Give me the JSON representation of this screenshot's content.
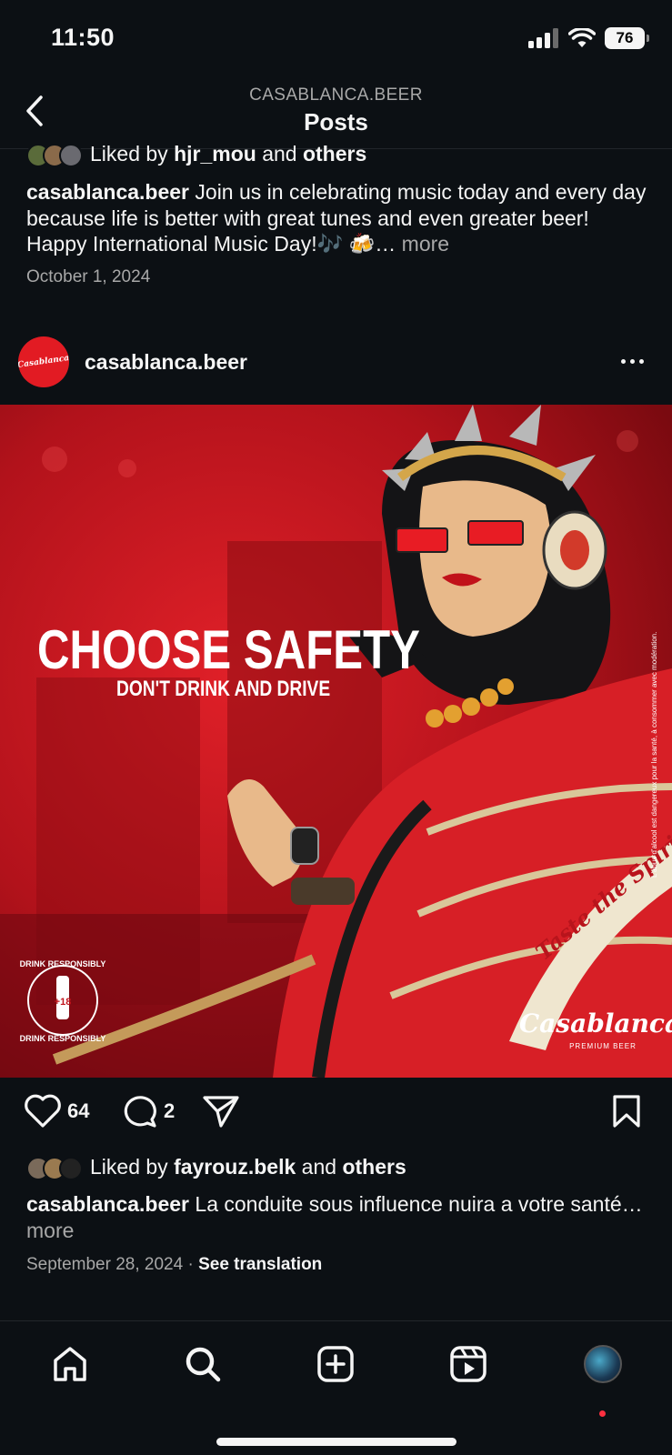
{
  "status": {
    "time": "11:50",
    "battery": "76"
  },
  "header": {
    "subtitle": "CASABLANCA.BEER",
    "title": "Posts"
  },
  "previous_post": {
    "liked_prefix": "Liked by",
    "liked_user": "hjr_mou",
    "liked_and": "and",
    "liked_others": "others",
    "username": "casablanca.beer",
    "caption": "Join us in celebrating music today and every day because life is better with great tunes and even greater beer!  Happy International Music Day!🎶 🍻…",
    "more": "more",
    "date": "October 1, 2024"
  },
  "post": {
    "username": "casablanca.beer",
    "avatar_text": "Casablanca",
    "image": {
      "headline": "CHOOSE SAFETY",
      "subheadline": "DON'T DRINK AND DRIVE",
      "badge_top": "DRINK RESPONSIBLY",
      "badge_bottom": "DRINK RESPONSIBLY",
      "badge_age": "+18",
      "ribbon": "Taste the Spirit o",
      "brand": "Casablanca",
      "brand_sub": "PREMIUM BEER",
      "side_note": "L'abus d'alcool est dangereux pour la santé, à consommer avec modération."
    },
    "likes_count": "64",
    "comments_count": "2",
    "liked_prefix": "Liked by",
    "liked_user": "fayrouz.belk",
    "liked_and": "and",
    "liked_others": "others",
    "caption": "La conduite sous influence nuira a votre santé…",
    "more": "more",
    "date": "September 28, 2024",
    "separator": "·",
    "see_translation": "See translation"
  },
  "tabs": [
    "home-icon",
    "search-icon",
    "create-icon",
    "reels-icon",
    "profile-avatar"
  ],
  "colors": {
    "background": "#0c1014",
    "text": "#f5f5f5",
    "muted": "#a8a8a8",
    "brand_red": "#e21b23",
    "notification": "#ff3040"
  }
}
